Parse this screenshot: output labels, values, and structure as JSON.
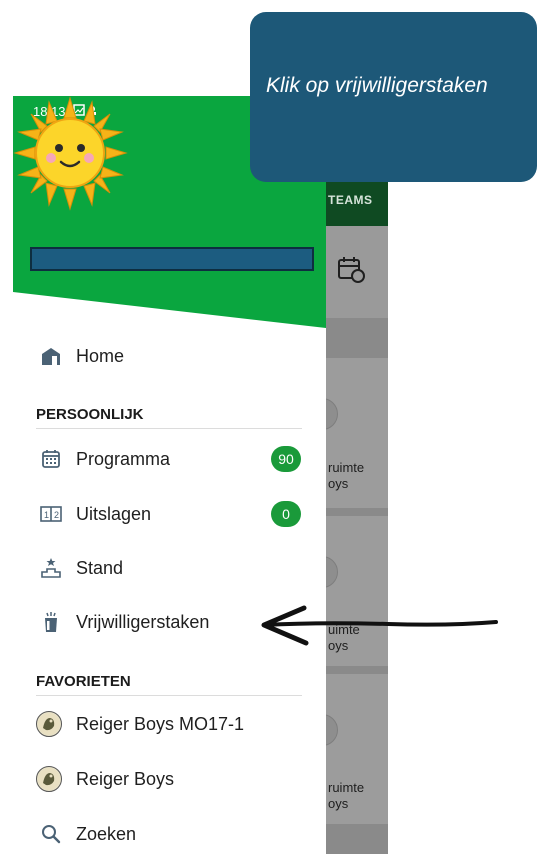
{
  "status_bar": {
    "time": "18:13"
  },
  "background_app": {
    "tab_label": "TEAMS",
    "cards": [
      {
        "line1": "ruimte",
        "line2": "oys"
      },
      {
        "line1": "uimte",
        "line2": "oys"
      },
      {
        "line1": "ruimte",
        "line2": "oys"
      }
    ]
  },
  "drawer": {
    "home_label": "Home",
    "sections": {
      "personal": "PERSOONLIJK",
      "favorites": "FAVORIETEN"
    },
    "personal_items": [
      {
        "label": "Programma",
        "badge": "90"
      },
      {
        "label": "Uitslagen",
        "badge": "0"
      },
      {
        "label": "Stand"
      },
      {
        "label": "Vrijwilligerstaken"
      }
    ],
    "favorite_items": [
      {
        "label": "Reiger Boys MO17-1"
      },
      {
        "label": "Reiger Boys"
      }
    ],
    "search_label": "Zoeken"
  },
  "callout": {
    "text": "Klik op vrijwilligerstaken"
  },
  "colors": {
    "brand_green": "#0aa63f",
    "dark_green": "#0f4a22",
    "badge_green": "#1a9a3a",
    "callout_blue": "#1d5878"
  }
}
